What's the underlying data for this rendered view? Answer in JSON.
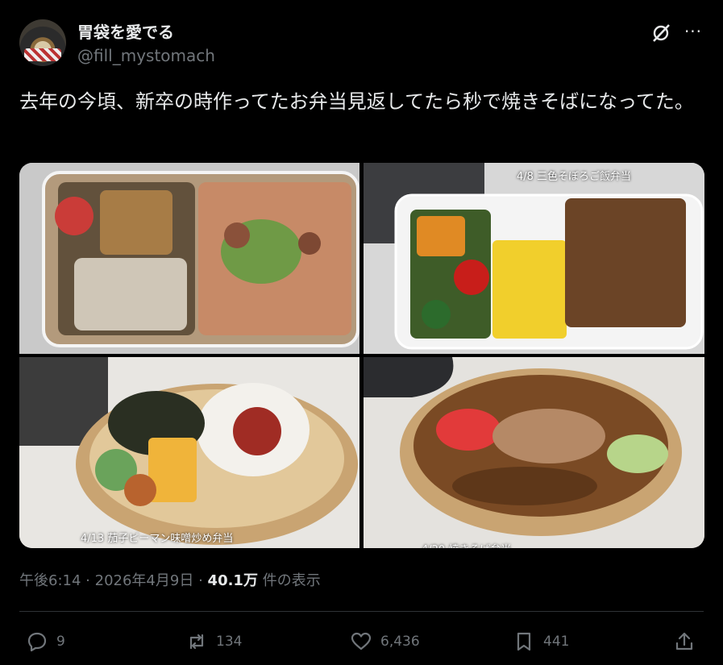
{
  "author": {
    "display_name": "胃袋を愛でる",
    "handle": "@fill_mystomach"
  },
  "icons": {
    "grok": "grok-icon",
    "more": "more-icon",
    "reply": "reply-icon",
    "repost": "repost-icon",
    "like": "heart-icon",
    "bookmark": "bookmark-icon",
    "share": "share-icon"
  },
  "tweet": {
    "text": "去年の今頃、新卒の時作ってたお弁当見返してたら秒で焼きそばになってた。"
  },
  "media": {
    "captions": {
      "tile2": "4/8 三色そぼろご飯弁当",
      "tile3": "4/13 茄子ピーマン味噌炒め弁当",
      "tile4": "4/20 焼きそば弁当"
    }
  },
  "meta": {
    "time": "午後6:14",
    "date": "2026年4月9日",
    "separator": "·",
    "views_count": "40.1万",
    "views_label": "件の表示"
  },
  "actions": {
    "replies": "9",
    "reposts": "134",
    "likes": "6,436",
    "bookmarks": "441"
  },
  "colors": {
    "background": "#000000",
    "text": "#e7e9ea",
    "secondary_text": "#71767b",
    "divider": "#2f3336"
  }
}
